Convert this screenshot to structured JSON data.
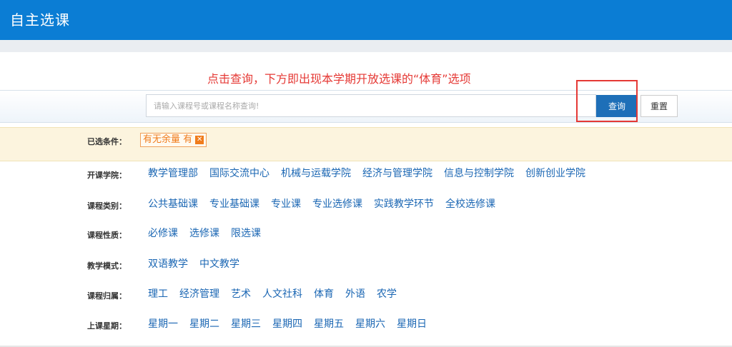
{
  "header": {
    "title": "自主选课"
  },
  "annotation": {
    "text": "点击查询，下方即出现本学期开放选课的“体育”选项"
  },
  "search": {
    "placeholder": "请输入课程号或课程名称查询!",
    "query_label": "查询",
    "reset_label": "重置"
  },
  "selected": {
    "label": "已选条件：",
    "chip": "有无余量 有",
    "remove_icon": "close-icon"
  },
  "filters": [
    {
      "label": "开课学院：",
      "options": [
        "教学管理部",
        "国际交流中心",
        "机械与运载学院",
        "经济与管理学院",
        "信息与控制学院",
        "创新创业学院"
      ]
    },
    {
      "label": "课程类别：",
      "options": [
        "公共基础课",
        "专业基础课",
        "专业课",
        "专业选修课",
        "实践教学环节",
        "全校选修课"
      ]
    },
    {
      "label": "课程性质：",
      "options": [
        "必修课",
        "选修课",
        "限选课"
      ]
    },
    {
      "label": "教学模式：",
      "options": [
        "双语教学",
        "中文教学"
      ]
    },
    {
      "label": "课程归属：",
      "options": [
        "理工",
        "经济管理",
        "艺术",
        "人文社科",
        "体育",
        "外语",
        "农学"
      ]
    },
    {
      "label": "上课星期：",
      "options": [
        "星期一",
        "星期二",
        "星期三",
        "星期四",
        "星期五",
        "星期六",
        "星期日"
      ]
    }
  ],
  "colors": {
    "header": "#0b7dd4",
    "link": "#1a66b3",
    "annotation": "#e53935",
    "chip": "#f07c1c",
    "query_button": "#1e6fb8"
  }
}
